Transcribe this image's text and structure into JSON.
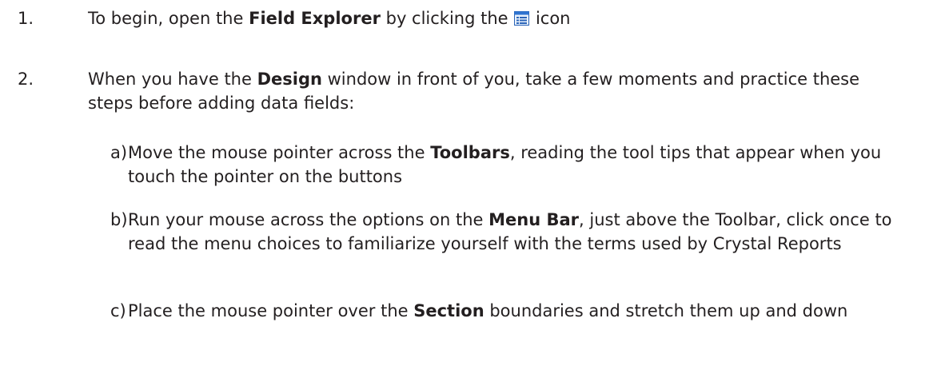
{
  "steps": [
    {
      "number": "1.",
      "pre": "To begin, open the ",
      "bold": "Field Explorer",
      "post": " by clicking the ",
      "icon": "field-explorer-icon",
      "after_icon": " icon"
    },
    {
      "number": "2.",
      "pre": "When you have the ",
      "bold": "Design",
      "post": " window in front of you, take a few moments and practice these steps before adding data fields:"
    }
  ],
  "substeps": [
    {
      "letter": "a)",
      "pre": "Move the mouse pointer across the ",
      "bold": "Toolbars",
      "post": ", reading the tool tips that appear when you touch the pointer on the buttons"
    },
    {
      "letter": "b)",
      "pre": "Run your mouse across the options on the ",
      "bold": "Menu Bar",
      "post": ", just above the Toolbar, click once to read the menu choices to familiarize yourself with the terms used by Crystal Reports"
    },
    {
      "letter": "c)",
      "pre": "Place the mouse pointer over the ",
      "bold": "Section",
      "post": " boundaries and stretch them up and down"
    }
  ]
}
